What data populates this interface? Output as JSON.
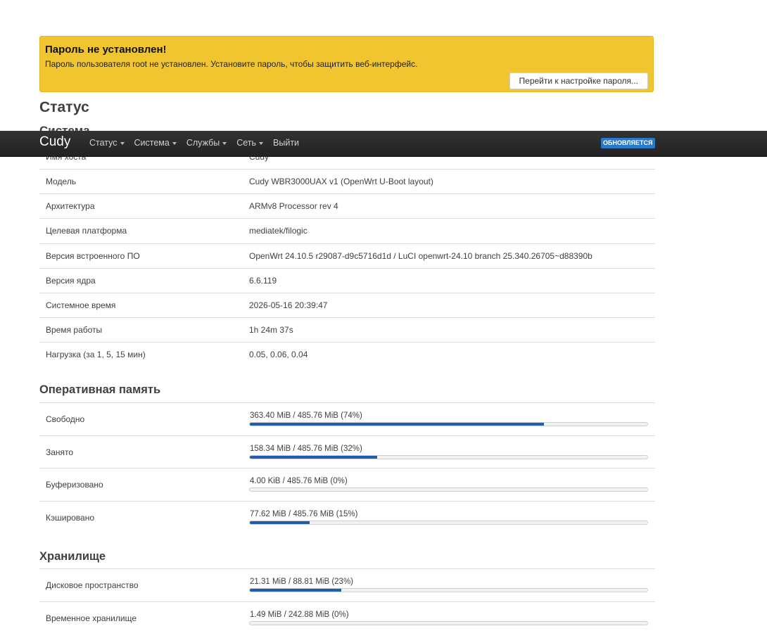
{
  "alert": {
    "title": "Пароль не установлен!",
    "text": "Пароль пользователя root не установлен. Установите пароль, чтобы защитить веб-интерфейс.",
    "button": "Перейти к настройке пароля..."
  },
  "page_title": "Статус",
  "navbar": {
    "brand": "Cudy",
    "menu": [
      "Статус",
      "Система",
      "Службы",
      "Сеть",
      "Выйти"
    ],
    "badge": "ОБНОВЛЯЕТСЯ"
  },
  "system": {
    "title": "Система",
    "hidden_row": {
      "label": "Имя хоста",
      "value": "Cudy"
    },
    "rows": [
      {
        "label": "Модель",
        "value": "Cudy WBR3000UAX v1 (OpenWrt U-Boot layout)"
      },
      {
        "label": "Архитектура",
        "value": "ARMv8 Processor rev 4"
      },
      {
        "label": "Целевая платформа",
        "value": "mediatek/filogic"
      },
      {
        "label": "Версия встроенного ПО",
        "value": "OpenWrt 24.10.5 r29087-d9c5716d1d / LuCI openwrt-24.10 branch 25.340.26705~d88390b"
      },
      {
        "label": "Версия ядра",
        "value": "6.6.119"
      },
      {
        "label": "Системное время",
        "value": "2026-05-16 20:39:47"
      },
      {
        "label": "Время работы",
        "value": "1h 24m 37s"
      },
      {
        "label": "Нагрузка (за 1, 5, 15 мин)",
        "value": "0.05, 0.06, 0.04"
      }
    ]
  },
  "memory": {
    "title": "Оперативная память",
    "rows": [
      {
        "label": "Свободно",
        "text": "363.40 MiB / 485.76 MiB (74%)",
        "percent": 74
      },
      {
        "label": "Занято",
        "text": "158.34 MiB / 485.76 MiB (32%)",
        "percent": 32
      },
      {
        "label": "Буферизовано",
        "text": "4.00 KiB / 485.76 MiB (0%)",
        "percent": 0
      },
      {
        "label": "Кэшировано",
        "text": "77.62 MiB / 485.76 MiB (15%)",
        "percent": 15
      }
    ]
  },
  "storage": {
    "title": "Хранилище",
    "rows": [
      {
        "label": "Дисковое пространство",
        "text": "21.31 MiB / 88.81 MiB (23%)",
        "percent": 23
      },
      {
        "label": "Временное хранилище",
        "text": "1.49 MiB / 242.88 MiB (0%)",
        "percent": 0
      }
    ]
  },
  "colors": {
    "accent": "#1e5fa8",
    "alert_bg": "#f1c530",
    "badge_bg": "#2a78c8",
    "navbar_bg": "#222222"
  }
}
